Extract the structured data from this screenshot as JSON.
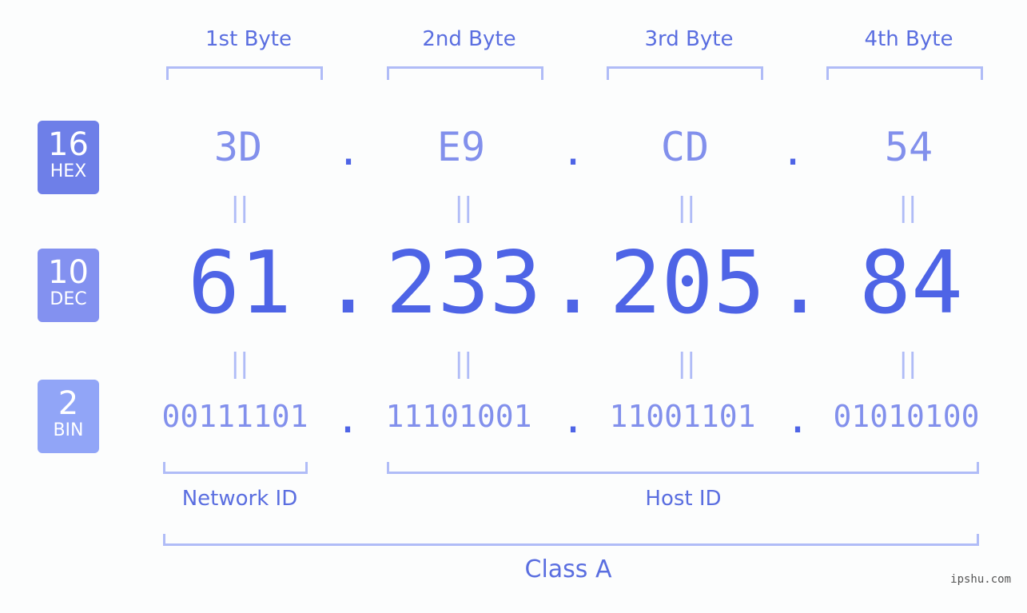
{
  "bytes": [
    {
      "label": "1st Byte",
      "hex": "3D",
      "dec": "61",
      "bin": "00111101"
    },
    {
      "label": "2nd Byte",
      "hex": "E9",
      "dec": "233",
      "bin": "11101001"
    },
    {
      "label": "3rd Byte",
      "hex": "CD",
      "dec": "205",
      "bin": "11001101"
    },
    {
      "label": "4th Byte",
      "hex": "54",
      "dec": "84",
      "bin": "01010100"
    }
  ],
  "badges": {
    "hex": {
      "num": "16",
      "label": "HEX",
      "color": "#6e7fe8"
    },
    "dec": {
      "num": "10",
      "label": "DEC",
      "color": "#8391f0"
    },
    "bin": {
      "num": "2",
      "label": "BIN",
      "color": "#91a5f7"
    }
  },
  "separator": ".",
  "equals": "||",
  "segments": {
    "network": "Network ID",
    "host": "Host ID",
    "class": "Class A"
  },
  "watermark": "ipshu.com"
}
